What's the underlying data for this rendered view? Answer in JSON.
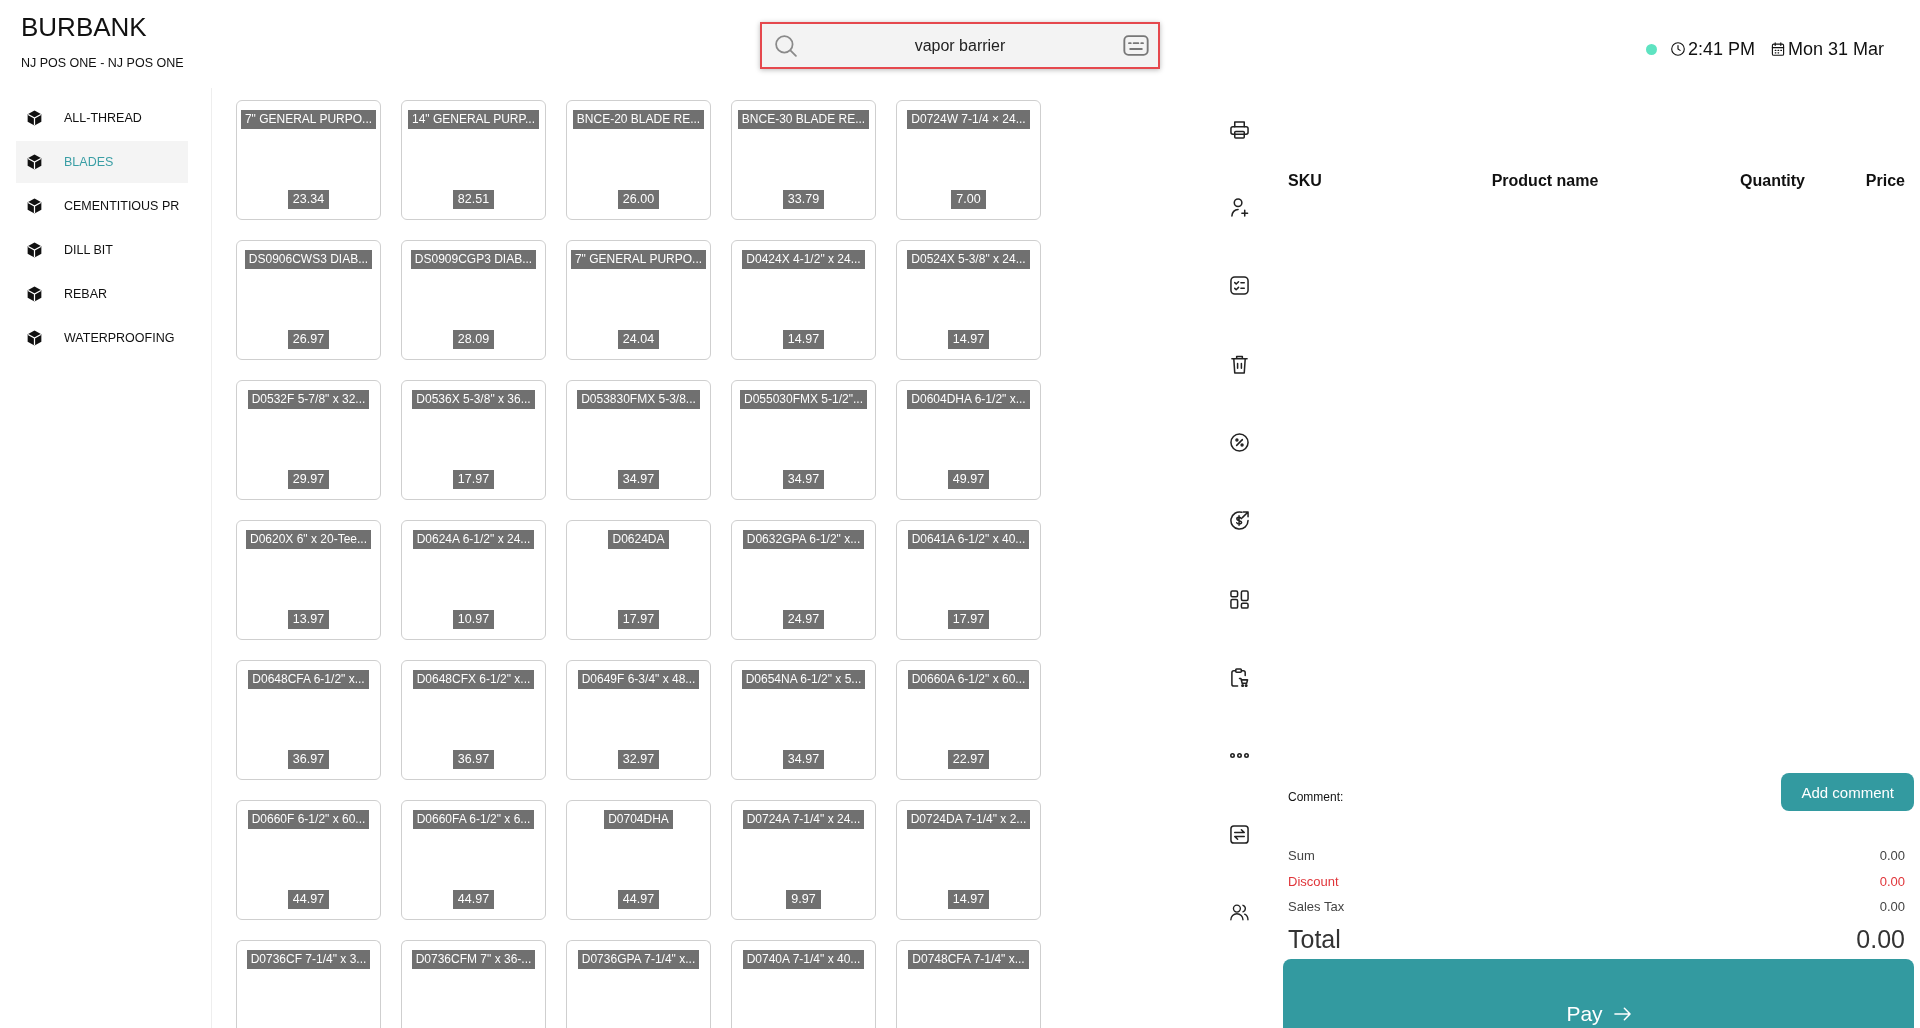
{
  "header": {
    "store_name": "BURBANK",
    "register": "NJ POS ONE - NJ POS ONE"
  },
  "search": {
    "value": "vapor barrier"
  },
  "status": {
    "online": true,
    "time": "2:41 PM",
    "date": "Mon 31 Mar"
  },
  "categories": [
    {
      "label": "ALL-THREAD",
      "selected": false
    },
    {
      "label": "BLADES",
      "selected": true
    },
    {
      "label": "CEMENTITIOUS PR",
      "selected": false
    },
    {
      "label": "DILL BIT",
      "selected": false
    },
    {
      "label": "REBAR",
      "selected": false
    },
    {
      "label": "WATERPROOFING",
      "selected": false
    }
  ],
  "products": [
    {
      "name": "7\" GENERAL PURPO...",
      "price": "23.34"
    },
    {
      "name": "14\" GENERAL PURP...",
      "price": "82.51"
    },
    {
      "name": "BNCE-20 BLADE RE...",
      "price": "26.00"
    },
    {
      "name": "BNCE-30 BLADE RE...",
      "price": "33.79"
    },
    {
      "name": "D0724W 7-1/4 × 24...",
      "price": "7.00"
    },
    {
      "name": "DS0906CWS3 DIAB...",
      "price": "26.97"
    },
    {
      "name": "DS0909CGP3 DIAB...",
      "price": "28.09"
    },
    {
      "name": "7\" GENERAL PURPO...",
      "price": "24.04"
    },
    {
      "name": "D0424X 4-1/2\" x 24...",
      "price": "14.97"
    },
    {
      "name": "D0524X 5-3/8\" x 24...",
      "price": "14.97"
    },
    {
      "name": "D0532F 5-7/8\" x 32...",
      "price": "29.97"
    },
    {
      "name": "D0536X 5-3/8\" x 36...",
      "price": "17.97"
    },
    {
      "name": "D053830FMX 5-3/8...",
      "price": "34.97"
    },
    {
      "name": "D055030FMX 5-1/2\"...",
      "price": "34.97"
    },
    {
      "name": "D0604DHA 6-1/2\" x...",
      "price": "49.97"
    },
    {
      "name": "D0620X 6\" x 20-Tee...",
      "price": "13.97"
    },
    {
      "name": "D0624A 6-1/2\" x 24...",
      "price": "10.97"
    },
    {
      "name": "D0624DA",
      "price": "17.97"
    },
    {
      "name": "D0632GPA 6-1/2\" x...",
      "price": "24.97"
    },
    {
      "name": "D0641A 6-1/2\" x 40...",
      "price": "17.97"
    },
    {
      "name": "D0648CFA 6-1/2\" x...",
      "price": "36.97"
    },
    {
      "name": "D0648CFX 6-1/2\" x...",
      "price": "36.97"
    },
    {
      "name": "D0649F 6-3/4\" x 48...",
      "price": "32.97"
    },
    {
      "name": "D0654NA 6-1/2\" x 5...",
      "price": "34.97"
    },
    {
      "name": "D0660A 6-1/2\" x 60...",
      "price": "22.97"
    },
    {
      "name": "D0660F 6-1/2\" x 60...",
      "price": "44.97"
    },
    {
      "name": "D0660FA 6-1/2\" x 6...",
      "price": "44.97"
    },
    {
      "name": "D0704DHA",
      "price": "44.97"
    },
    {
      "name": "D0724A 7-1/4\" x 24...",
      "price": "9.97"
    },
    {
      "name": "D0724DA 7-1/4\" x 2...",
      "price": "14.97"
    },
    {
      "name": "D0736CF 7-1/4\" x 3..."
    },
    {
      "name": "D0736CFM 7\" x 36-..."
    },
    {
      "name": "D0736GPA 7-1/4\" x..."
    },
    {
      "name": "D0740A 7-1/4\" x 40..."
    },
    {
      "name": "D0748CFA 7-1/4\" x..."
    }
  ],
  "toolbar": [
    {
      "kind": "print"
    },
    {
      "kind": "add-customer"
    },
    {
      "kind": "checklist"
    },
    {
      "kind": "delete"
    },
    {
      "kind": "discount"
    },
    {
      "kind": "cashback"
    },
    {
      "kind": "apps"
    },
    {
      "kind": "cart"
    },
    {
      "kind": "more"
    },
    {
      "kind": "swap"
    },
    {
      "kind": "customers"
    }
  ],
  "order": {
    "columns": [
      "SKU",
      "Product name",
      "Quantity",
      "Price"
    ],
    "comment": {
      "label": "Comment:",
      "button": "Add comment"
    },
    "summary": [
      {
        "label": "Sum",
        "value": "0.00",
        "kind": "plain"
      },
      {
        "label": "Discount",
        "value": "0.00",
        "kind": "discount"
      },
      {
        "label": "Sales Tax",
        "value": "0.00",
        "kind": "plain"
      }
    ],
    "total": {
      "label": "Total",
      "value": "0.00"
    },
    "pay_button": {
      "label": "Pay"
    }
  }
}
